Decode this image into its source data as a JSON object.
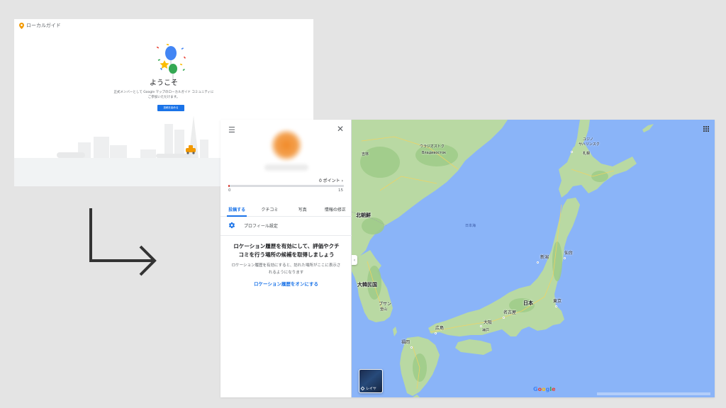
{
  "welcome": {
    "brand": "ローカルガイド",
    "title": "ようこそ",
    "desc_line1": "正式メンバーとして Google マップのローカルガイド コミュニティに",
    "desc_line2": "ご参加いただけます。",
    "join_button": "投稿を始める"
  },
  "panel": {
    "points_label": "0 ポイント ›",
    "progress": {
      "min": "0",
      "max": "15",
      "value": 0,
      "fraction": 0.0
    },
    "tabs": [
      {
        "label": "投稿する",
        "active": true
      },
      {
        "label": "クチコミ",
        "active": false
      },
      {
        "label": "写真",
        "active": false
      },
      {
        "label": "情報の修正",
        "active": false
      }
    ],
    "profile_setting": "プロフィール設定",
    "headline_line1": "ロケーション履歴を有効にして、評価やクチ",
    "headline_line2": "コミを行う場所の候補を取得しましょう",
    "subtext_line1": "ロケーション履歴を有効にすると、訪れた場所がここに表示さ",
    "subtext_line2": "れるようになります",
    "enable_link": "ロケーション履歴をオンにする"
  },
  "map": {
    "layer_label": "レイヤ",
    "logo": "Google",
    "labels": {
      "north_korea": "北朝鮮",
      "south_korea": "大韓民国",
      "japan": "日本",
      "sea_of_japan": "日本海",
      "vladivostok_jp": "ウラジオストク",
      "vladivostok_ru": "Владивосток",
      "jilin": "吉林",
      "yuzhno": "ユジノ",
      "sakhalinsk": "サハリンスク",
      "sapporo": "札幌",
      "niigata": "新潟",
      "sendai": "仙台",
      "tokyo": "東京",
      "nagoya": "名古屋",
      "osaka": "大阪",
      "kobe": "神戸",
      "hiroshima": "広島",
      "fukuoka": "福岡",
      "busan": "プサン",
      "busan_alt": "釜山"
    },
    "colors": {
      "water": "#8ab4f8",
      "land": "#b9d9a3",
      "land_dark": "#9ecb88",
      "roads": "#f4d35e"
    }
  },
  "colors": {
    "accent": "#1a73e8",
    "progress": "#d93025",
    "arrow": "#333333"
  }
}
